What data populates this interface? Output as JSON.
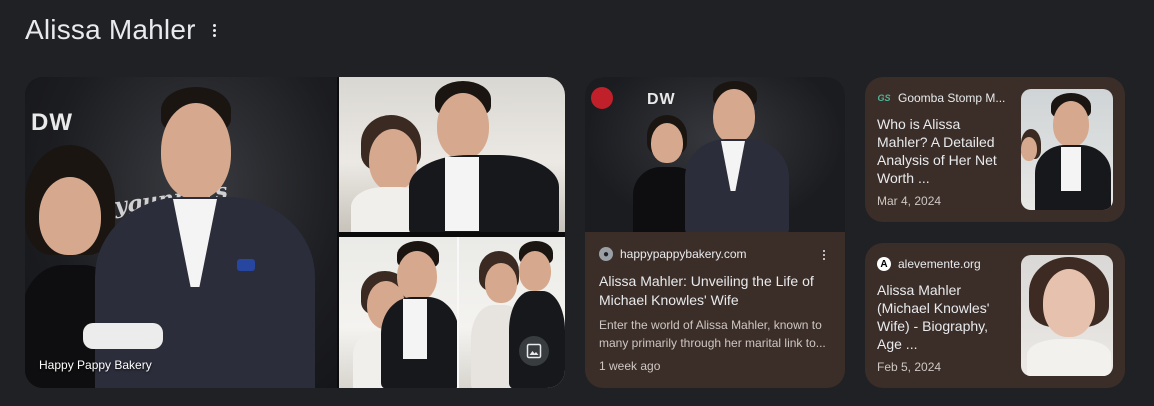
{
  "header": {
    "title": "Alissa Mahler"
  },
  "collage": {
    "caption": "Happy Pappy Bakery",
    "logo_text": "DW",
    "brand_script": "Ladygunners"
  },
  "cards": [
    {
      "source": "happypappybakery.com",
      "title": "Alissa Mahler: Unveiling the Life of Michael Knowles' Wife",
      "snippet_line1": "Enter the world of Alissa Mahler, known to",
      "snippet_line2": "many primarily through her marital link to...",
      "date": "1 week ago",
      "logo_text": "DW"
    },
    {
      "source": "Goomba Stomp M...",
      "title_lines": [
        "Who is Alissa",
        "Mahler? A Detailed",
        "Analysis of Her Net",
        "Worth ..."
      ],
      "date": "Mar 4, 2024",
      "favicon": "GS"
    },
    {
      "source": "alevemente.org",
      "title_lines": [
        "Alissa Mahler",
        "(Michael Knowles'",
        "Wife) - Biography,",
        "Age ..."
      ],
      "date": "Feb 5, 2024",
      "favicon": "A"
    }
  ],
  "icons": {
    "more": "more-vert-icon",
    "image": "image-icon"
  },
  "colors": {
    "background": "#202124",
    "card": "#3b2e28",
    "text": "#e8eaed"
  }
}
